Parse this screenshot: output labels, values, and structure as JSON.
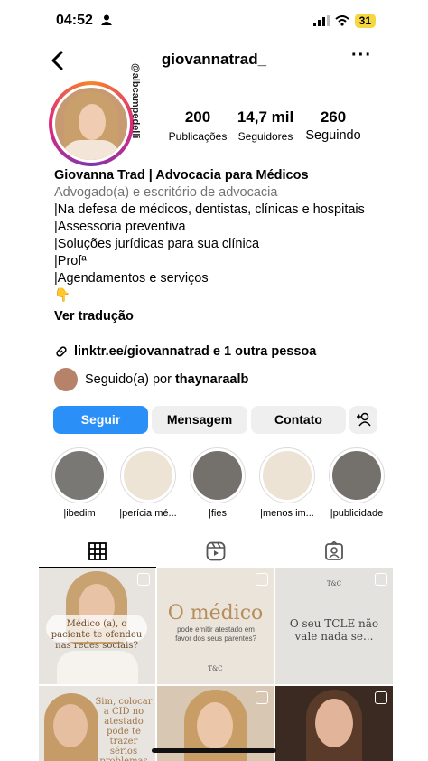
{
  "status": {
    "time": "04:52",
    "battery": "31"
  },
  "nav": {
    "username": "giovannatrad_"
  },
  "avatar": {
    "handle_overlay": "@albcampedelli"
  },
  "stats": [
    {
      "value": "200",
      "label": "Publicações"
    },
    {
      "value": "14,7 mil",
      "label": "Seguidores"
    },
    {
      "value": "260",
      "label": "Seguindo"
    }
  ],
  "bio": {
    "name": "Giovanna Trad | Advocacia para Médicos",
    "category": "Advogado(a) e escritório de advocacia",
    "lines": [
      "|Na defesa de médicos, dentistas, clínicas e hospitais",
      "|Assessoria preventiva",
      "|Soluções jurídicas para sua clínica",
      "|Profª",
      "|Agendamentos e serviços",
      "👇"
    ],
    "translate": "Ver tradução",
    "link": "linktr.ee/giovannatrad e 1 outra pessoa",
    "followed_prefix": "Seguido(a) por",
    "followed_user": "thaynaraalb"
  },
  "buttons": {
    "follow": "Seguir",
    "message": "Mensagem",
    "contact": "Contato"
  },
  "highlights": [
    {
      "label": "|ibedim",
      "color": "#7a7874"
    },
    {
      "label": "|perícia mé...",
      "color": "#ede4d6"
    },
    {
      "label": "|fies",
      "color": "#74716c"
    },
    {
      "label": "|menos im...",
      "color": "#ece3d4"
    },
    {
      "label": "|publicidade",
      "color": "#74716c"
    }
  ],
  "posts": [
    {
      "text": "Médico (a), o paciente te ofendeu nas redes sociais?"
    },
    {
      "text_main": "O médico",
      "text_sub": "pode emitir atestado em favor dos seus parentes?",
      "brand": "T&C"
    },
    {
      "text": "O seu TCLE não vale nada se...",
      "brand": "T&C"
    },
    {
      "text": "Sim, colocar a CID no atestado pode te trazer sérios problemas"
    },
    {
      "text": ""
    },
    {
      "text": ""
    }
  ]
}
